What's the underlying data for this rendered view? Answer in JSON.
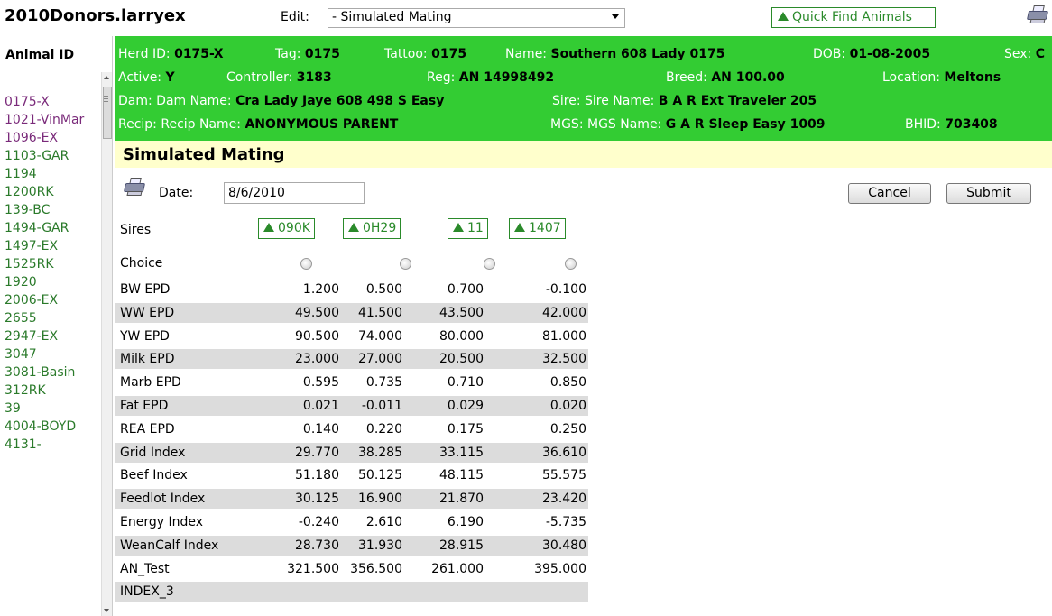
{
  "app": {
    "title": "2010Donors.larryex",
    "edit_label": "Edit:",
    "edit_value": "- Simulated Mating",
    "quick_find_label": "Quick Find Animals"
  },
  "left": {
    "header": "Animal ID",
    "animals": [
      {
        "id": "0175-X",
        "style": "purple"
      },
      {
        "id": "1021-VinMar",
        "style": "purple"
      },
      {
        "id": "1096-EX",
        "style": "purple"
      },
      {
        "id": "1103-GAR",
        "style": "green"
      },
      {
        "id": "1194",
        "style": "green"
      },
      {
        "id": "1200RK",
        "style": "green"
      },
      {
        "id": "139-BC",
        "style": "green"
      },
      {
        "id": "1494-GAR",
        "style": "green"
      },
      {
        "id": "1497-EX",
        "style": "green"
      },
      {
        "id": "1525RK",
        "style": "green"
      },
      {
        "id": "1920",
        "style": "green"
      },
      {
        "id": "2006-EX",
        "style": "green"
      },
      {
        "id": "2655",
        "style": "green"
      },
      {
        "id": "2947-EX",
        "style": "green"
      },
      {
        "id": "3047",
        "style": "green"
      },
      {
        "id": "3081-Basin",
        "style": "green"
      },
      {
        "id": "312RK",
        "style": "green"
      },
      {
        "id": "39",
        "style": "green"
      },
      {
        "id": "4004-BOYD",
        "style": "green"
      },
      {
        "id": "4131-",
        "style": "green"
      }
    ]
  },
  "animal": {
    "herd_id_label": "Herd ID:",
    "herd_id": "0175-X",
    "tag_label": "Tag:",
    "tag": "0175",
    "tattoo_label": "Tattoo:",
    "tattoo": "0175",
    "name_label": "Name:",
    "name": "Southern 608 Lady 0175",
    "dob_label": "DOB:",
    "dob": "01-08-2005",
    "sex_label": "Sex:",
    "sex": "C",
    "active_label": "Active:",
    "active": "Y",
    "controller_label": "Controller:",
    "controller": "3183",
    "reg_label": "Reg:",
    "reg": "AN 14998492",
    "breed_label": "Breed:",
    "breed": "AN 100.00",
    "location_label": "Location:",
    "location": "Meltons",
    "dam_label": "Dam:",
    "dam_name_label": "Dam Name:",
    "dam_name": "Cra Lady Jaye 608 498 S Easy",
    "sire_label": "Sire:",
    "sire_name_label": "Sire Name:",
    "sire_name": "B A R Ext Traveler 205",
    "recip_label": "Recip:",
    "recip_name_label": "Recip Name:",
    "recip_name": "ANONYMOUS PARENT",
    "mgs_label": "MGS:",
    "mgs_name_label": "MGS Name:",
    "mgs_name": "G A R Sleep Easy 1009",
    "bhid_label": "BHID:",
    "bhid": "703408"
  },
  "section": {
    "title": "Simulated Mating"
  },
  "form": {
    "date_label": "Date:",
    "date_value": "8/6/2010",
    "cancel_label": "Cancel",
    "submit_label": "Submit"
  },
  "grid": {
    "sires_label": "Sires",
    "choice_label": "Choice",
    "sires": [
      "090K",
      "0H29",
      "11",
      "1407"
    ],
    "rows": [
      {
        "label": "BW EPD",
        "values": [
          "1.200",
          "0.500",
          "0.700",
          "-0.100"
        ]
      },
      {
        "label": "WW EPD",
        "values": [
          "49.500",
          "41.500",
          "43.500",
          "42.000"
        ]
      },
      {
        "label": "YW EPD",
        "values": [
          "90.500",
          "74.000",
          "80.000",
          "81.000"
        ]
      },
      {
        "label": "Milk EPD",
        "values": [
          "23.000",
          "27.000",
          "20.500",
          "32.500"
        ]
      },
      {
        "label": "Marb EPD",
        "values": [
          "0.595",
          "0.735",
          "0.710",
          "0.850"
        ]
      },
      {
        "label": "Fat EPD",
        "values": [
          "0.021",
          "-0.011",
          "0.029",
          "0.020"
        ]
      },
      {
        "label": "REA EPD",
        "values": [
          "0.140",
          "0.220",
          "0.175",
          "0.250"
        ]
      },
      {
        "label": "Grid Index",
        "values": [
          "29.770",
          "38.285",
          "33.115",
          "36.610"
        ]
      },
      {
        "label": "Beef Index",
        "values": [
          "51.180",
          "50.125",
          "48.115",
          "55.575"
        ]
      },
      {
        "label": "Feedlot Index",
        "values": [
          "30.125",
          "16.900",
          "21.870",
          "23.420"
        ]
      },
      {
        "label": "Energy Index",
        "values": [
          "-0.240",
          "2.610",
          "6.190",
          "-5.735"
        ]
      },
      {
        "label": "WeanCalf Index",
        "values": [
          "28.730",
          "31.930",
          "28.915",
          "30.480"
        ]
      },
      {
        "label": "AN_Test",
        "values": [
          "321.500",
          "356.500",
          "261.000",
          "395.000"
        ]
      },
      {
        "label": "INDEX_3",
        "values": [
          "",
          "",
          "",
          ""
        ]
      }
    ]
  }
}
